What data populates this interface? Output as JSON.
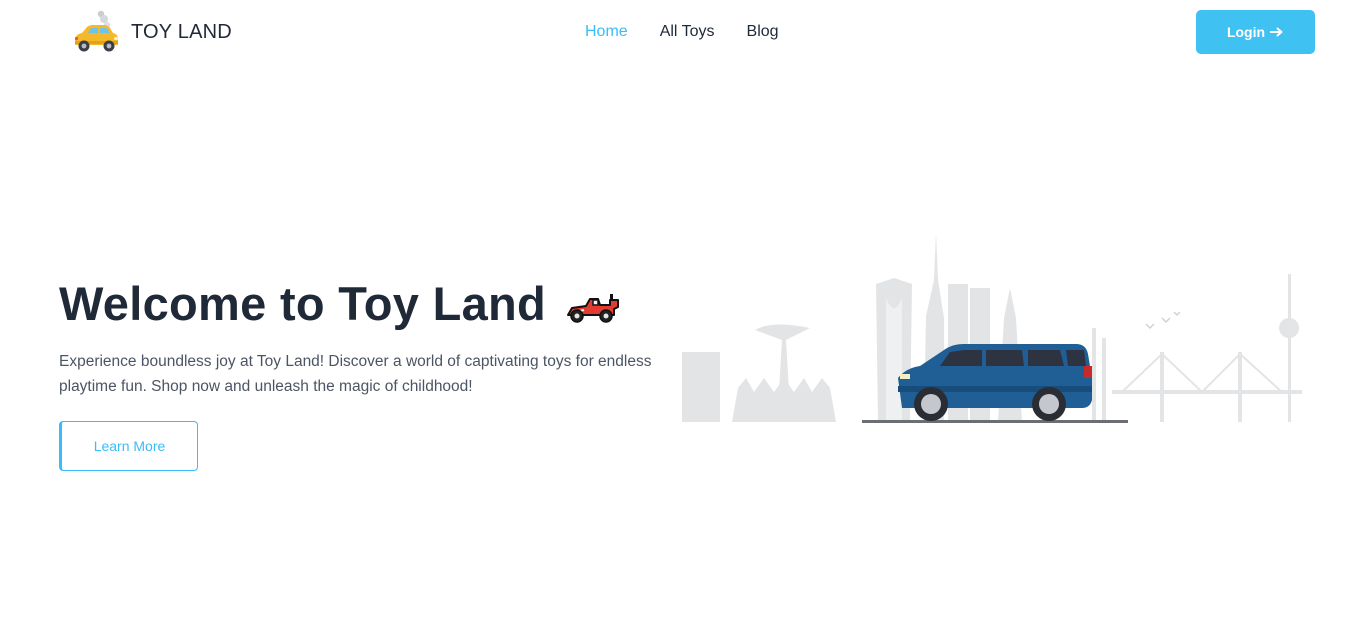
{
  "header": {
    "brand_name": "TOY LAND",
    "nav": [
      {
        "label": "Home",
        "active": true
      },
      {
        "label": "All Toys",
        "active": false
      },
      {
        "label": "Blog",
        "active": false
      }
    ],
    "login_label": "Login"
  },
  "hero": {
    "title": "Welcome to Toy Land",
    "description": "Experience boundless joy at Toy Land! Discover a world of captivating toys for endless playtime fun. Shop now and unleash the magic of childhood!",
    "cta_label": "Learn More"
  },
  "icons": {
    "brand_logo": "taxi-car-icon",
    "title_icon": "racing-car-icon",
    "login_icon": "arrow-right-icon"
  },
  "colors": {
    "accent": "#38bdf8",
    "login_bg": "#3fc1f2",
    "text_dark": "#1f2937",
    "text_muted": "#4b5563",
    "car_blue": "#1f5f96",
    "skyline_gray": "#e3e4e6"
  }
}
